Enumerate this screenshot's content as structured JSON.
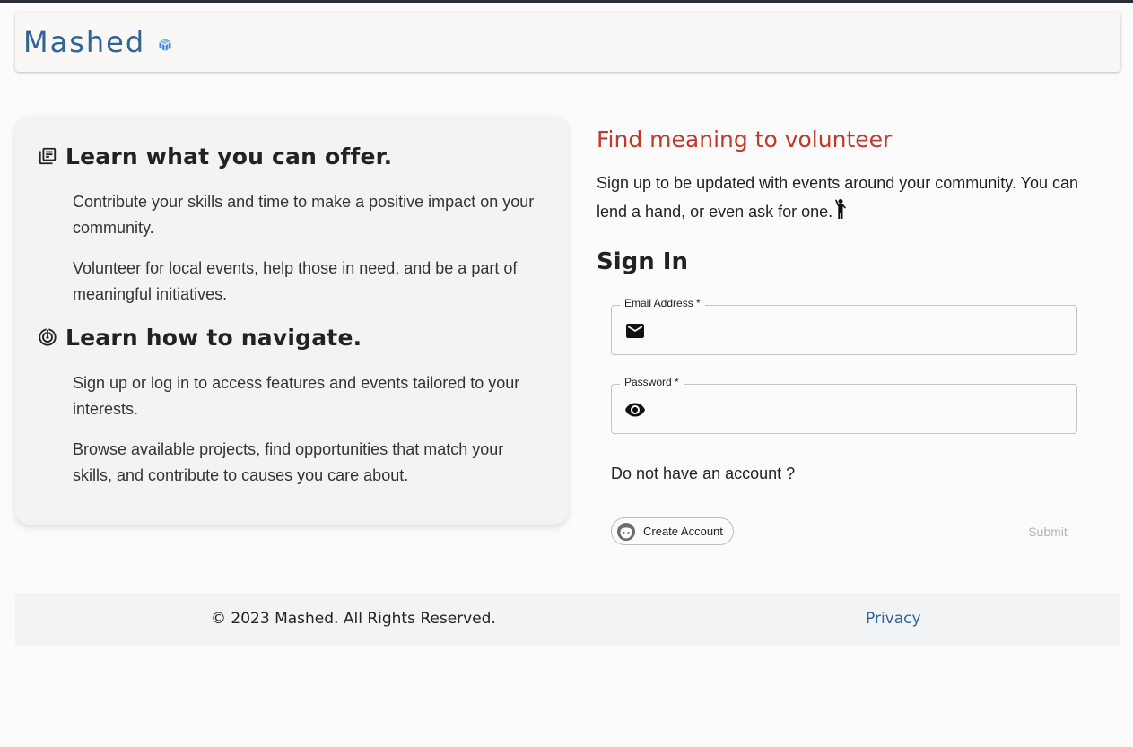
{
  "header": {
    "brand": "Mashed",
    "brand_icon": "cube-icon",
    "brand_color": "#2f6494"
  },
  "info": {
    "sections": [
      {
        "icon": "library-books-icon",
        "title": "Learn what you can offer.",
        "paragraphs": [
          "Contribute your skills and time to make a positive impact on your community.",
          "Volunteer for local events, help those in need, and be a part of meaningful initiatives."
        ]
      },
      {
        "icon": "radar-icon",
        "title": "Learn how to navigate.",
        "paragraphs": [
          "Sign up or log in to access features and events tailored to your interests.",
          "Browse available projects, find opportunities that match your skills, and contribute to causes you care about."
        ]
      }
    ]
  },
  "signin": {
    "tagline": "Find meaning to volunteer",
    "tagline_color": "#c0392b",
    "description": "Sign up to be updated with events around your community. You can lend a hand, or even ask for one.",
    "description_icon": "person-waving-icon",
    "title": "Sign In",
    "email_label": "Email Address *",
    "email_value": "",
    "email_icon": "mail-icon",
    "password_label": "Password *",
    "password_value": "",
    "password_icon": "eye-icon",
    "no_account": "Do not have an account ?",
    "create_account": "Create Account",
    "create_account_icon": "face-avatar-icon",
    "submit": "Submit"
  },
  "footer": {
    "copyright": "© 2023 Mashed. All Rights Reserved.",
    "privacy": "Privacy"
  }
}
